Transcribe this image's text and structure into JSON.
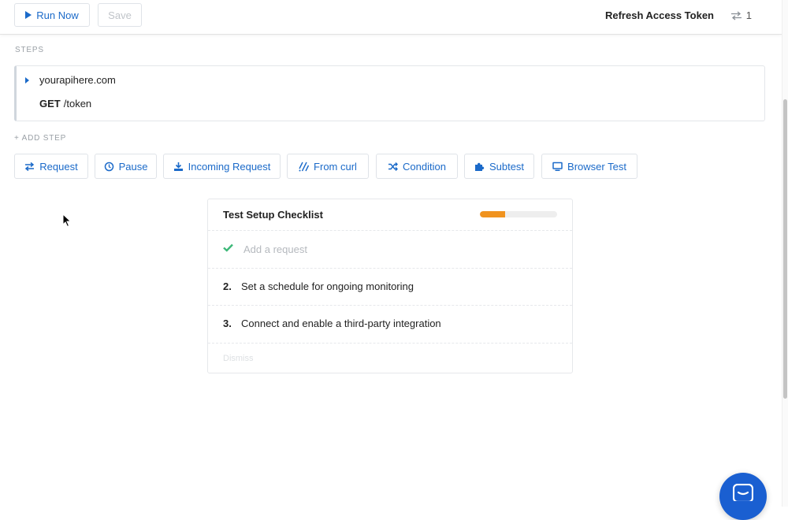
{
  "toolbar": {
    "run_label": "Run Now",
    "save_label": "Save",
    "test_name": "Refresh Access Token",
    "sync_count": "1"
  },
  "steps": {
    "section_label": "STEPS",
    "items": [
      {
        "host": "yourapihere.com",
        "method": "GET",
        "path": "/token"
      }
    ],
    "add_label": "+ ADD STEP"
  },
  "step_types": [
    {
      "label": "Request",
      "icon": "arrows-exchange-icon"
    },
    {
      "label": "Pause",
      "icon": "clock-icon"
    },
    {
      "label": "Incoming Request",
      "icon": "download-icon"
    },
    {
      "label": "From curl",
      "icon": "slashes-icon"
    },
    {
      "label": "Condition",
      "icon": "shuffle-icon"
    },
    {
      "label": "Subtest",
      "icon": "puzzle-icon"
    },
    {
      "label": "Browser Test",
      "icon": "monitor-icon"
    }
  ],
  "checklist": {
    "title": "Test Setup Checklist",
    "progress": 0.33,
    "items": [
      {
        "num": "",
        "text": "Add a request",
        "done": true
      },
      {
        "num": "2.",
        "text": "Set a schedule for ongoing monitoring",
        "done": false
      },
      {
        "num": "3.",
        "text": "Connect and enable a third-party integration",
        "done": false
      }
    ],
    "dismiss_label": "Dismiss"
  },
  "colors": {
    "accent": "#1b6ac9",
    "progress": "#f0931f",
    "check": "#3cb878",
    "chat": "#1a5fd1"
  }
}
